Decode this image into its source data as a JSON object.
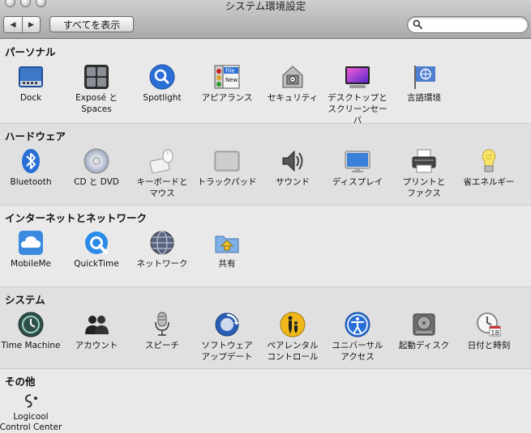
{
  "window": {
    "title": "システム環境設定"
  },
  "toolbar": {
    "back_label": "◀",
    "forward_label": "▶",
    "show_all_label": "すべてを表示",
    "search_value": "",
    "search_placeholder": ""
  },
  "sections": [
    {
      "title": "パーソナル",
      "items": [
        {
          "label": "Dock",
          "icon": "dock-icon"
        },
        {
          "label": "Exposé と\nSpaces",
          "icon": "expose-spaces-icon"
        },
        {
          "label": "Spotlight",
          "icon": "spotlight-icon"
        },
        {
          "label": "アピアランス",
          "icon": "appearance-icon"
        },
        {
          "label": "セキュリティ",
          "icon": "security-icon"
        },
        {
          "label": "デスクトップと\nスクリーンセーバ",
          "icon": "desktop-screensaver-icon"
        },
        {
          "label": "言語環境",
          "icon": "language-icon"
        }
      ]
    },
    {
      "title": "ハードウェア",
      "items": [
        {
          "label": "Bluetooth",
          "icon": "bluetooth-icon"
        },
        {
          "label": "CD と DVD",
          "icon": "cd-dvd-icon"
        },
        {
          "label": "キーボードと\nマウス",
          "icon": "keyboard-mouse-icon"
        },
        {
          "label": "トラックパッド",
          "icon": "trackpad-icon"
        },
        {
          "label": "サウンド",
          "icon": "sound-icon"
        },
        {
          "label": "ディスプレイ",
          "icon": "display-icon"
        },
        {
          "label": "プリントと\nファクス",
          "icon": "print-fax-icon"
        },
        {
          "label": "省エネルギー",
          "icon": "energy-saver-icon"
        }
      ]
    },
    {
      "title": "インターネットとネットワーク",
      "items": [
        {
          "label": "MobileMe",
          "icon": "mobileme-icon"
        },
        {
          "label": "QuickTime",
          "icon": "quicktime-icon"
        },
        {
          "label": "ネットワーク",
          "icon": "network-icon"
        },
        {
          "label": "共有",
          "icon": "sharing-icon"
        }
      ]
    },
    {
      "title": "システム",
      "items": [
        {
          "label": "Time Machine",
          "icon": "time-machine-icon"
        },
        {
          "label": "アカウント",
          "icon": "accounts-icon"
        },
        {
          "label": "スピーチ",
          "icon": "speech-icon"
        },
        {
          "label": "ソフトウェア\nアップデート",
          "icon": "software-update-icon"
        },
        {
          "label": "ペアレンタル\nコントロール",
          "icon": "parental-controls-icon"
        },
        {
          "label": "ユニバーサル\nアクセス",
          "icon": "universal-access-icon"
        },
        {
          "label": "起動ディスク",
          "icon": "startup-disk-icon"
        },
        {
          "label": "日付と時刻",
          "icon": "date-time-icon"
        }
      ]
    },
    {
      "title": "その他",
      "items": [
        {
          "label": "Logicool\nControl Center",
          "icon": "logicool-control-center-icon"
        }
      ]
    }
  ],
  "icon_text": {
    "appearance_file": "File",
    "appearance_new": "New",
    "date_day": "18",
    "logicool_word": "Logicool"
  },
  "colors": {
    "accent_blue": "#2a6fd6",
    "toolbar_top": "#cfcfcf",
    "toolbar_bottom": "#a9a9a9"
  }
}
